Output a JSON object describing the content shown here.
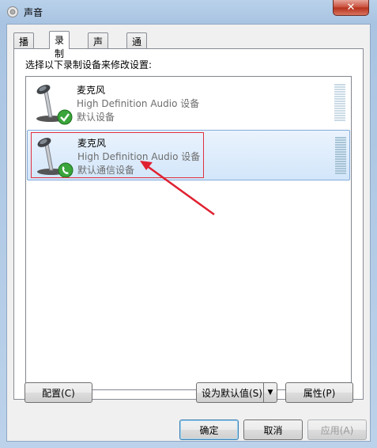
{
  "window": {
    "title": "声音"
  },
  "tabs": [
    {
      "label": "播放"
    },
    {
      "label": "录制"
    },
    {
      "label": "声音"
    },
    {
      "label": "通信"
    }
  ],
  "instruction": "选择以下录制设备来修改设置:",
  "devices": [
    {
      "name": "麦克风",
      "description": "High Definition Audio 设备",
      "status": "默认设备",
      "status_icon": "check-icon"
    },
    {
      "name": "麦克风",
      "description": "High Definition Audio 设备",
      "status": "默认通信设备",
      "status_icon": "phone-icon"
    }
  ],
  "buttons": {
    "configure": "配置(C)",
    "set_default": "设为默认值(S)",
    "properties": "属性(P)",
    "ok": "确定",
    "cancel": "取消",
    "apply": "应用(A)"
  },
  "colors": {
    "highlight_border": "#e03040",
    "arrow": "#e02030",
    "selection": "#d3e6fa"
  }
}
